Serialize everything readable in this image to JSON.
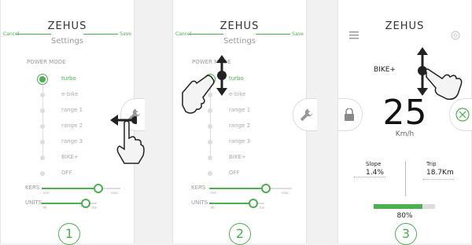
{
  "screens": [
    {
      "logo": "ZEHUS",
      "header": {
        "cancel": "Cancel",
        "save": "Save",
        "title": "Settings"
      },
      "power_mode_label": "POWER MODE",
      "modes": [
        "turbo",
        "e-bike",
        "range 1",
        "range 2",
        "range 3",
        "BIKE+",
        "OFF"
      ],
      "selected_mode": "turbo",
      "kers": {
        "label": "KERS",
        "min": "min",
        "max": "max"
      },
      "units": {
        "label": "UNITS",
        "mi": "Mi",
        "km": "Km"
      },
      "step": "1"
    },
    {
      "logo": "ZEHUS",
      "header": {
        "cancel": "Cancel",
        "save": "Save",
        "title": "Settings"
      },
      "power_mode_label": "POWER MODE",
      "modes": [
        "turbo",
        "e-bike",
        "range 1",
        "range 2",
        "range 3",
        "BIKE+",
        "OFF"
      ],
      "selected_mode": "turbo",
      "kers": {
        "label": "KERS",
        "min": "min",
        "max": "max"
      },
      "units": {
        "label": "UNITS",
        "mi": "Mi",
        "km": "Km"
      },
      "step": "2"
    },
    {
      "logo": "ZEHUS",
      "mode": "BIKE+",
      "speed": "25",
      "speed_unit": "Km/h",
      "slope_label": "Slope",
      "slope_value": "1.4%",
      "trip_label": "Trip",
      "trip_value": "18.7Km",
      "battery": "80%",
      "step": "3"
    }
  ],
  "colors": {
    "accent": "#4caf50"
  }
}
